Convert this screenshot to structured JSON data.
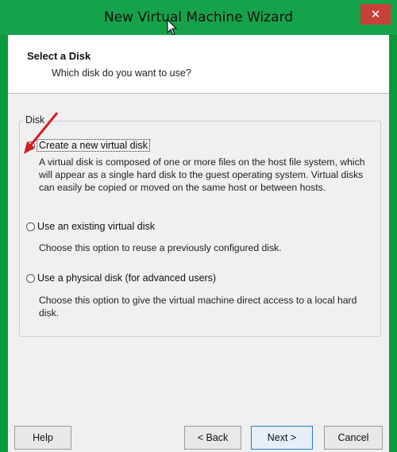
{
  "window": {
    "title": "New Virtual Machine Wizard",
    "close_icon": "close-icon",
    "accent_color": "#16a24a"
  },
  "header": {
    "title": "Select a Disk",
    "subtitle": "Which disk do you want to use?"
  },
  "disk_group": {
    "legend": "Disk",
    "options": [
      {
        "label": "Create a new virtual disk",
        "selected": true,
        "description": [
          "A virtual disk is composed of one or more files on the host file system, which",
          "will appear as a single hard disk to the guest operating system. Virtual disks",
          "can easily be copied or moved on the same host or between hosts."
        ]
      },
      {
        "label": "Use an existing virtual disk",
        "selected": false,
        "description": [
          "Choose this option to reuse a previously configured disk."
        ]
      },
      {
        "label": "Use a physical disk (for advanced users)",
        "selected": false,
        "description": [
          "Choose this option to give the virtual machine direct access to a local hard",
          "disk."
        ]
      }
    ]
  },
  "buttons": {
    "help": "Help",
    "back": "< Back",
    "next": "Next >",
    "cancel": "Cancel"
  }
}
